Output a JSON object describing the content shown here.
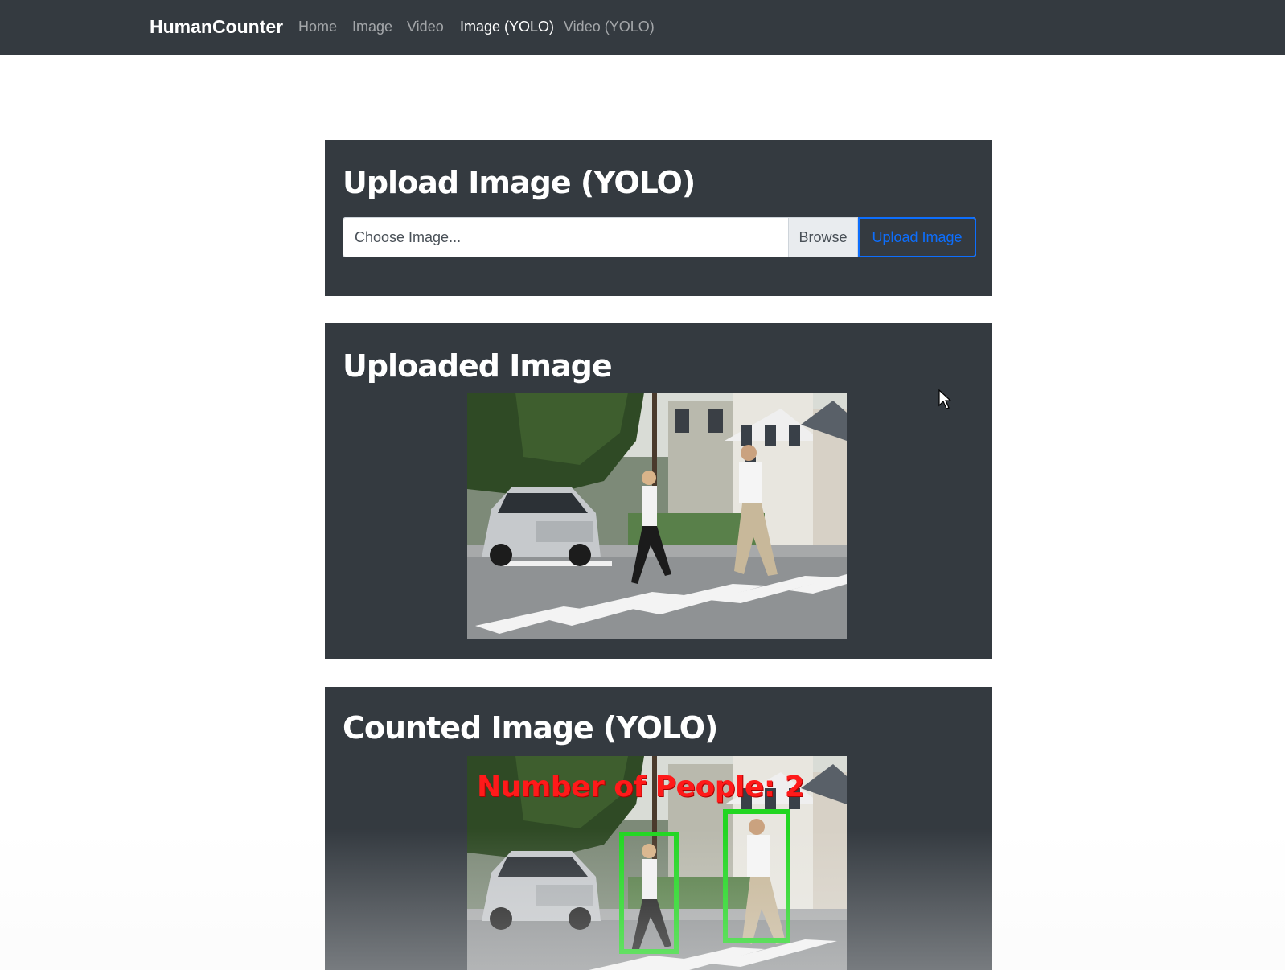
{
  "navbar": {
    "brand": "HumanCounter",
    "links": [
      {
        "label": "Home",
        "active": false
      },
      {
        "label": "Image",
        "active": false
      },
      {
        "label": "Video",
        "active": false
      },
      {
        "label": "Image (YOLO)",
        "active": true
      },
      {
        "label": "Video (YOLO)",
        "active": false
      }
    ]
  },
  "upload_card": {
    "title": "Upload Image (YOLO)",
    "file_placeholder": "Choose Image...",
    "browse_label": "Browse",
    "upload_label": "Upload Image"
  },
  "uploaded_card": {
    "title": "Uploaded Image"
  },
  "counted_card": {
    "title": "Counted Image (YOLO)",
    "overlay_text": "Number of People: 2",
    "detections": 2
  },
  "colors": {
    "navbar_bg": "#343a40",
    "card_bg": "#343a40",
    "accent": "#0d6efd",
    "count_text": "#ff1a1a",
    "bbox": "#21d621"
  }
}
